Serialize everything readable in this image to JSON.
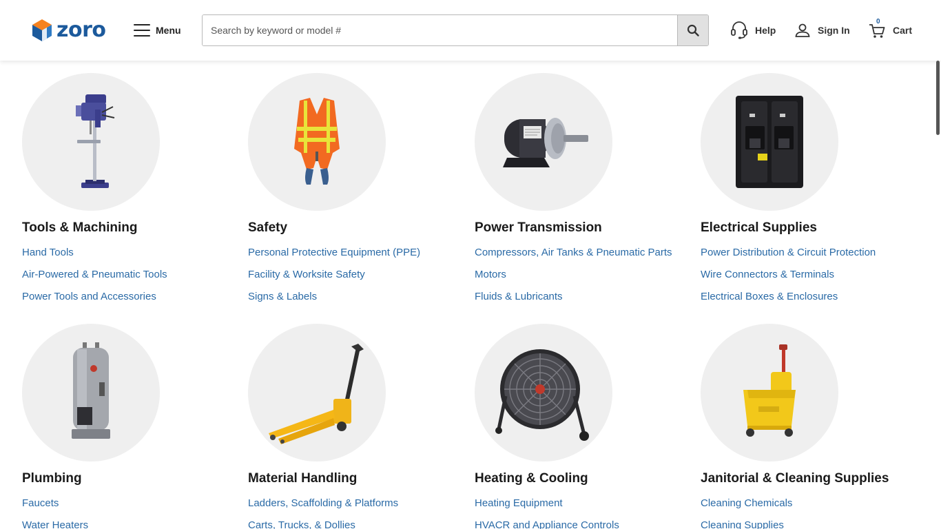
{
  "header": {
    "logo_text": "zoro",
    "menu_label": "Menu",
    "search_placeholder": "Search by keyword or model #",
    "search_value": "",
    "help_label": "Help",
    "signin_label": "Sign In",
    "cart_label": "Cart",
    "cart_count": "0"
  },
  "colors": {
    "brand_blue": "#1c5a9c",
    "brand_orange": "#f58220",
    "link_blue": "#2a6aa6",
    "circle_bg": "#efefef"
  },
  "categories": [
    {
      "title": "Tools & Machining",
      "image_icon": "drill-press-icon",
      "links": [
        "Hand Tools",
        "Air-Powered & Pneumatic Tools",
        "Power Tools and Accessories"
      ]
    },
    {
      "title": "Safety",
      "image_icon": "safety-vest-icon",
      "links": [
        "Personal Protective Equipment (PPE)",
        "Facility & Worksite Safety",
        "Signs & Labels"
      ]
    },
    {
      "title": "Power Transmission",
      "image_icon": "electric-motor-icon",
      "links": [
        "Compressors, Air Tanks & Pneumatic Parts",
        "Motors",
        "Fluids & Lubricants"
      ]
    },
    {
      "title": "Electrical Supplies",
      "image_icon": "circuit-breaker-icon",
      "links": [
        "Power Distribution & Circuit Protection",
        "Wire Connectors & Terminals",
        "Electrical Boxes & Enclosures"
      ]
    },
    {
      "title": "Plumbing",
      "image_icon": "water-heater-icon",
      "links": [
        "Faucets",
        "Water Heaters"
      ]
    },
    {
      "title": "Material Handling",
      "image_icon": "pallet-jack-icon",
      "links": [
        "Ladders, Scaffolding & Platforms",
        "Carts, Trucks, & Dollies"
      ]
    },
    {
      "title": "Heating & Cooling",
      "image_icon": "drum-fan-icon",
      "links": [
        "Heating Equipment",
        "HVACR and Appliance Controls"
      ]
    },
    {
      "title": "Janitorial & Cleaning Supplies",
      "image_icon": "mop-bucket-icon",
      "links": [
        "Cleaning Chemicals",
        "Cleaning Supplies"
      ]
    }
  ]
}
